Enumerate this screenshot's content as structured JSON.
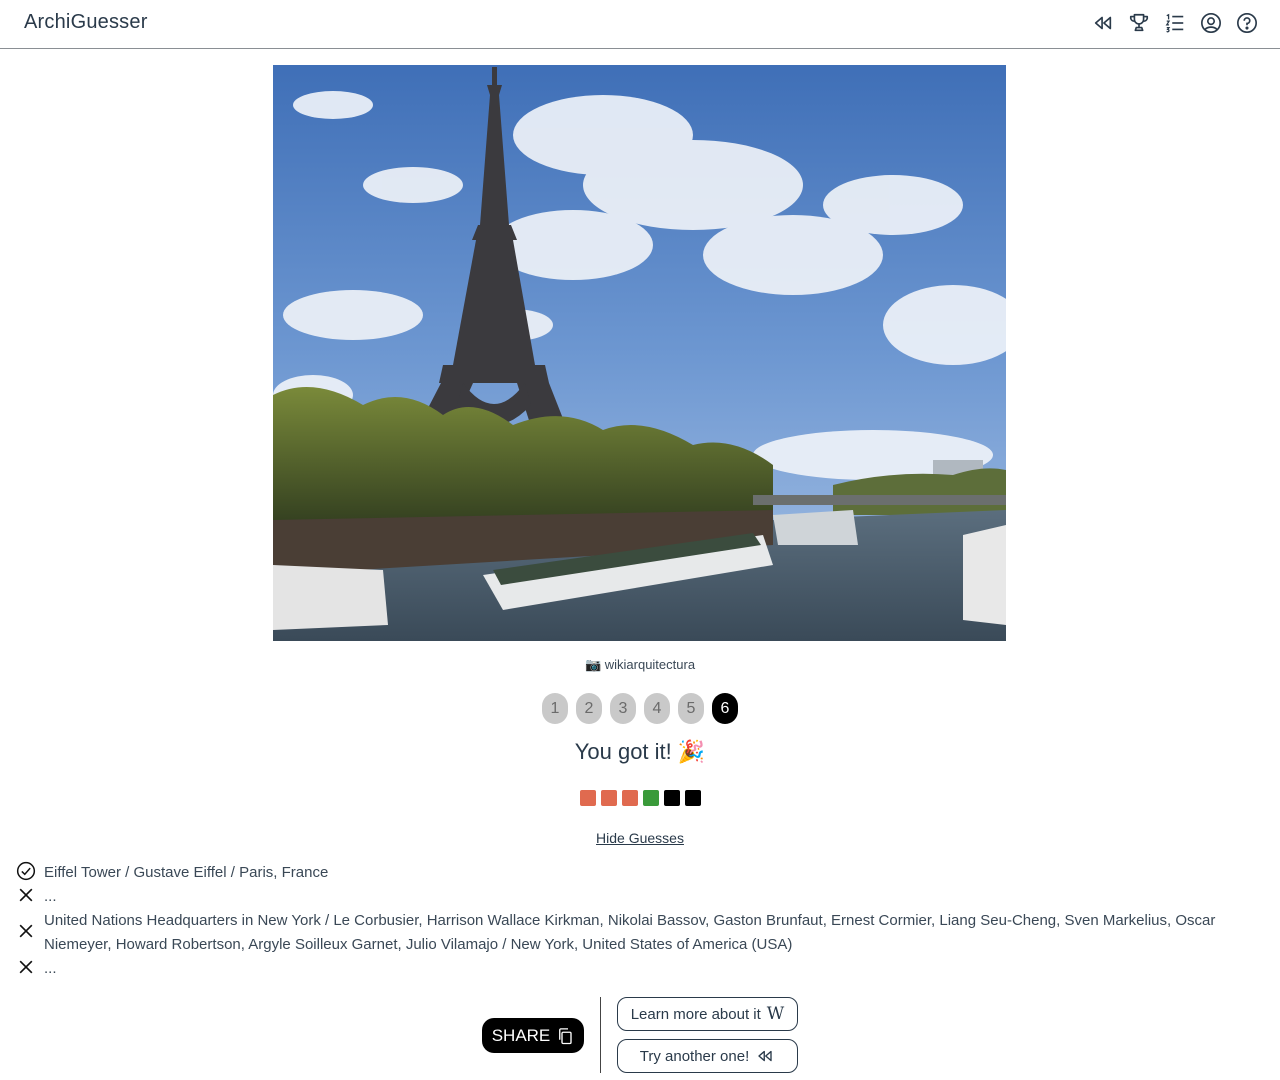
{
  "header": {
    "app_title": "ArchiGuesser",
    "icons": [
      "rewind-icon",
      "trophy-icon",
      "numbered-list-icon",
      "account-icon",
      "help-icon"
    ]
  },
  "photo": {
    "credit": "📷 wikiarquitectura"
  },
  "pager": {
    "pages": [
      "1",
      "2",
      "3",
      "4",
      "5",
      "6"
    ],
    "active": "6"
  },
  "result": {
    "message": "You got it! 🎉",
    "attempt_colors": [
      "#e06a4f",
      "#e06a4f",
      "#e06a4f",
      "#3a9a3a",
      "#000000",
      "#000000"
    ]
  },
  "hide_guesses_label": "Hide Guesses",
  "guesses": [
    {
      "status": "correct",
      "text": "Eiffel Tower / Gustave Eiffel / Paris, France"
    },
    {
      "status": "wrong",
      "text": "..."
    },
    {
      "status": "wrong",
      "text": "United Nations Headquarters in New York / Le Corbusier, Harrison Wallace Kirkman, Nikolai Bassov, Gaston Brunfaut, Ernest Cormier, Liang Seu-Cheng, Sven Markelius, Oscar Niemeyer, Howard Robertson, Argyle Soilleux Garnet, Julio Vilamajo / New York, United States of America (USA)"
    },
    {
      "status": "wrong",
      "text": "..."
    }
  ],
  "actions": {
    "share_label": "SHARE",
    "learn_more_label": "Learn more about it",
    "try_another_label": "Try another one!"
  },
  "colors": {
    "wrong": "#e06a4f",
    "correct": "#3a9a3a",
    "unused": "#000000",
    "text": "#2a3a4a"
  }
}
